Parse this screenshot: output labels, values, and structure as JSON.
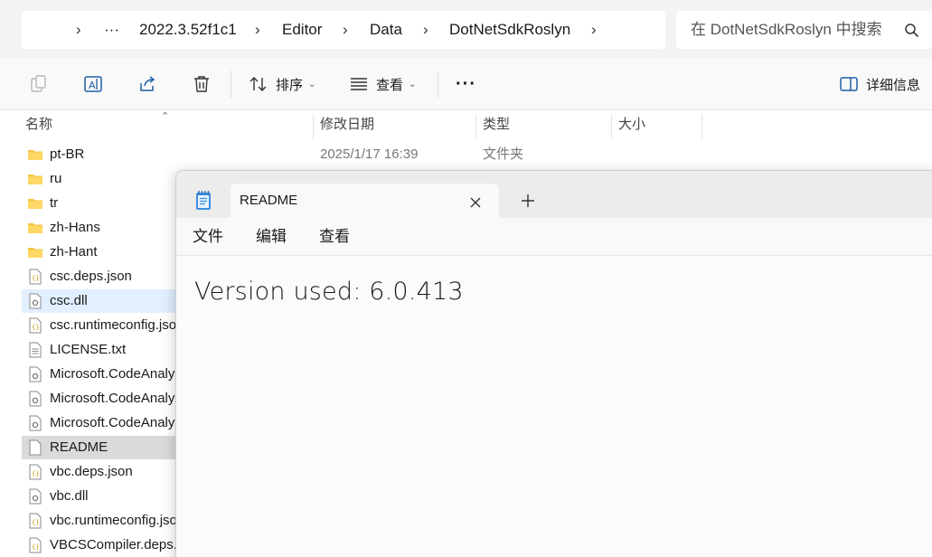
{
  "address_bar": {
    "overflow": "···",
    "breadcrumbs": [
      "2022.3.52f1c1",
      "Editor",
      "Data",
      "DotNetSdkRoslyn"
    ],
    "separator": "›",
    "search_placeholder": "在 DotNetSdkRoslyn 中搜索"
  },
  "command_bar": {
    "sort_label": "排序",
    "view_label": "查看",
    "more_label": "···",
    "details_label": "详细信息"
  },
  "file_list": {
    "columns": {
      "name": "名称",
      "date": "修改日期",
      "type": "类型",
      "size": "大小"
    },
    "rows": [
      {
        "name": "pt-BR",
        "icon": "folder-icon",
        "date": "2025/1/17 16:39",
        "type": "文件夹"
      },
      {
        "name": "ru",
        "icon": "folder-icon"
      },
      {
        "name": "tr",
        "icon": "folder-icon"
      },
      {
        "name": "zh-Hans",
        "icon": "folder-icon"
      },
      {
        "name": "zh-Hant",
        "icon": "folder-icon"
      },
      {
        "name": "csc.deps.json",
        "icon": "json-file-icon"
      },
      {
        "name": "csc.dll",
        "icon": "dll-file-icon"
      },
      {
        "name": "csc.runtimeconfig.json",
        "icon": "json-file-icon"
      },
      {
        "name": "LICENSE.txt",
        "icon": "text-file-icon"
      },
      {
        "name": "Microsoft.CodeAnalysis.CSharp.dll",
        "icon": "dll-file-icon"
      },
      {
        "name": "Microsoft.CodeAnalysis.dll",
        "icon": "dll-file-icon"
      },
      {
        "name": "Microsoft.CodeAnalysis.VisualBasic.dll",
        "icon": "dll-file-icon"
      },
      {
        "name": "README",
        "icon": "blank-file-icon"
      },
      {
        "name": "vbc.deps.json",
        "icon": "json-file-icon"
      },
      {
        "name": "vbc.dll",
        "icon": "dll-file-icon"
      },
      {
        "name": "vbc.runtimeconfig.json",
        "icon": "json-file-icon"
      },
      {
        "name": "VBCSCompiler.deps.json",
        "icon": "json-file-icon"
      }
    ]
  },
  "notepad": {
    "tab_title": "README",
    "menu": {
      "file": "文件",
      "edit": "编辑",
      "view": "查看"
    },
    "content": "Version used: 6.0.413"
  }
}
